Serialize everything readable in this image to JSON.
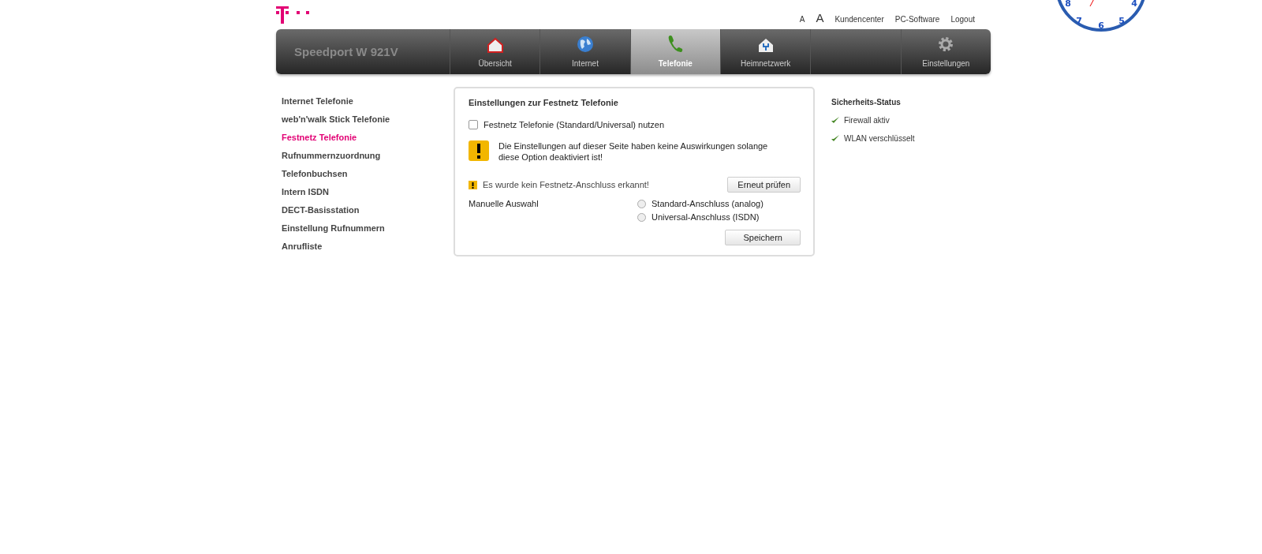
{
  "top_links": [
    {
      "label": "A",
      "kind": "small"
    },
    {
      "label": "A",
      "kind": "large"
    },
    {
      "label": "Kundencenter",
      "kind": "link"
    },
    {
      "label": "PC-Software",
      "kind": "link"
    },
    {
      "label": "Logout",
      "kind": "link"
    }
  ],
  "product": "Speedport W 921V",
  "tabs": [
    {
      "label": "Übersicht",
      "kind": "home",
      "selected": false
    },
    {
      "label": "Internet",
      "kind": "globe",
      "selected": false
    },
    {
      "label": "Telefonie",
      "kind": "phone",
      "selected": true
    },
    {
      "label": "Heimnetzwerk",
      "kind": "network",
      "selected": false
    },
    {
      "kind": "blank",
      "selected": false
    },
    {
      "label": "Einstellungen",
      "kind": "gear",
      "selected": false
    }
  ],
  "sidebar": {
    "items": [
      {
        "label": "Internet Telefonie",
        "selected": false
      },
      {
        "label": "web'n'walk Stick Telefonie",
        "selected": false
      },
      {
        "label": "Festnetz Telefonie",
        "selected": true
      },
      {
        "label": "Rufnummernzuordnung",
        "selected": false
      },
      {
        "label": "Telefonbuchsen",
        "selected": false
      },
      {
        "label": "Intern ISDN",
        "selected": false
      },
      {
        "label": "DECT-Basisstation",
        "selected": false
      },
      {
        "label": "Einstellung Rufnummern",
        "selected": false
      },
      {
        "label": "Anrufliste",
        "selected": false
      }
    ]
  },
  "panel": {
    "title": "Einstellungen zur Festnetz Telefonie",
    "use_checkbox": {
      "label": "Festnetz Telefonie (Standard/Universal) nutzen",
      "checked": false
    },
    "warning": "Die Einstellungen auf dieser Seite haben keine Auswirkungen solange diese Option deaktiviert ist!",
    "notice": "Es wurde kein Festnetz-Anschluss erkannt!",
    "recheck_button": "Erneut prüfen",
    "manual_label": "Manuelle Auswahl",
    "options": [
      {
        "label": "Standard-Anschluss (analog)",
        "selected": false
      },
      {
        "label": "Universal-Anschluss (ISDN)",
        "selected": false
      }
    ],
    "save_button": "Speichern"
  },
  "security": {
    "title": "Sicherheits-Status",
    "items": [
      {
        "label": "Firewall aktiv",
        "ok": true
      },
      {
        "label": "WLAN verschlüsselt",
        "ok": true
      }
    ]
  },
  "clock": {
    "numerals": [
      "8",
      "7",
      "6",
      "5",
      "4"
    ]
  }
}
